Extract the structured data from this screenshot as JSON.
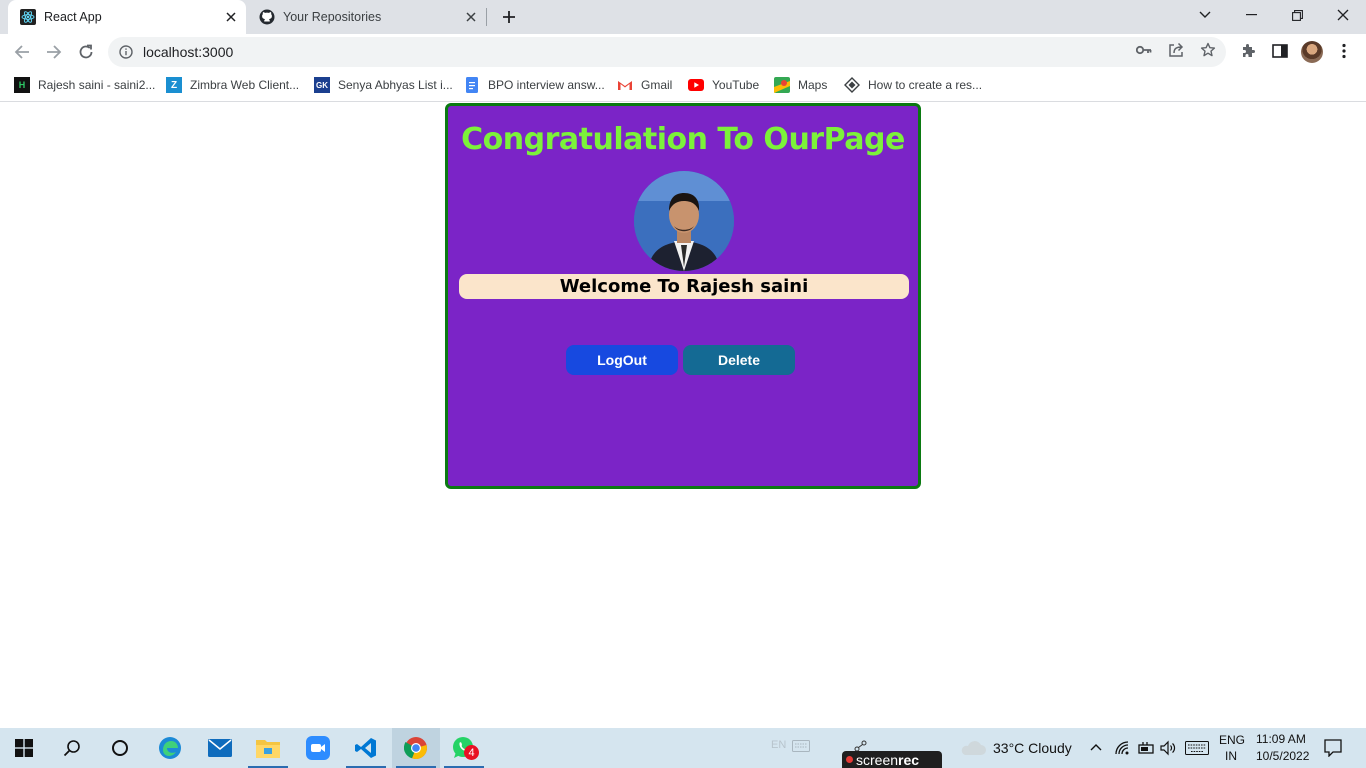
{
  "browser": {
    "tabs": [
      {
        "title": "React App",
        "active": true,
        "icon": "react-icon"
      },
      {
        "title": "Your Repositories",
        "active": false,
        "icon": "github-icon"
      }
    ],
    "address": "localhost:3000",
    "bookmarks": [
      {
        "label": "Rajesh saini - saini2...",
        "icon": "hackerrank-icon"
      },
      {
        "label": "Zimbra Web Client...",
        "icon": "zimbra-icon"
      },
      {
        "label": "Senya Abhyas List i...",
        "icon": "gk-icon"
      },
      {
        "label": "BPO interview answ...",
        "icon": "docs-icon"
      },
      {
        "label": "Gmail",
        "icon": "gmail-icon"
      },
      {
        "label": "YouTube",
        "icon": "youtube-icon"
      },
      {
        "label": "Maps",
        "icon": "maps-icon"
      },
      {
        "label": "How to create a res...",
        "icon": "diamond-icon"
      }
    ]
  },
  "page": {
    "title": "Congratulation To OurPage",
    "welcome": "Welcome To Rajesh saini",
    "logout_label": "LogOut",
    "delete_label": "Delete",
    "colors": {
      "card_bg": "#7b24c7",
      "card_border": "#0b7a12",
      "title": "#7cf23a",
      "welcome_bg": "#fbe5cb",
      "logout_bg": "#1749e0",
      "delete_bg": "#146a94"
    }
  },
  "taskbar": {
    "lang_hint": "EN",
    "weather": "33°C  Cloudy",
    "lang_top": "ENG",
    "lang_bottom": "IN",
    "time": "11:09 AM",
    "date": "10/5/2022",
    "whatsapp_badge": "4",
    "screenrec_left": "screen",
    "screenrec_right": "rec"
  }
}
